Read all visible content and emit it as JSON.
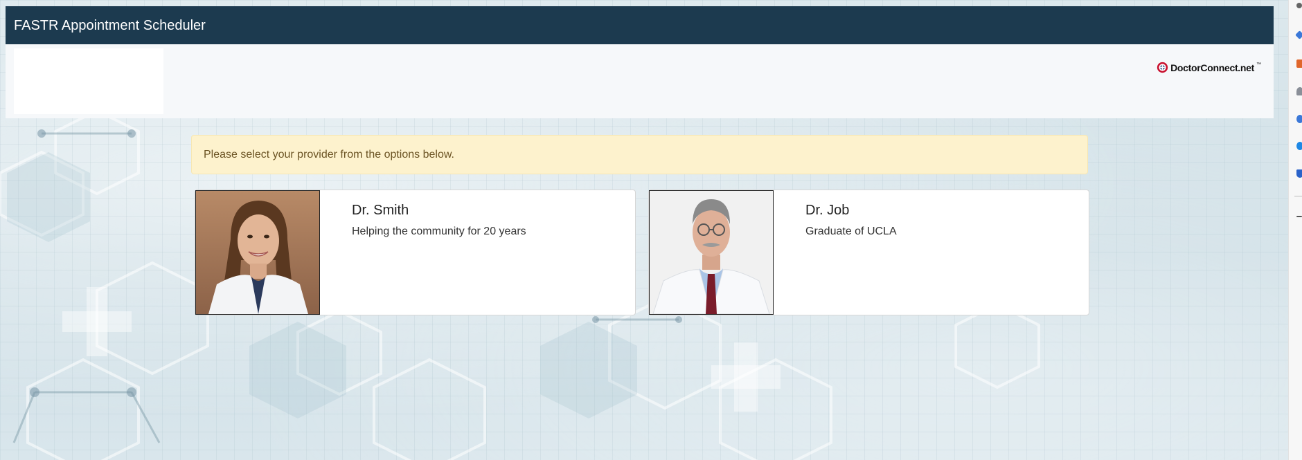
{
  "header": {
    "title": "FASTR Appointment Scheduler"
  },
  "branding": {
    "partner_logo_text": "DoctorConnect.net",
    "partner_logo_tm": "™",
    "header_color": "#1c3a4f"
  },
  "alert": {
    "message": "Please select your provider from the options below."
  },
  "providers": [
    {
      "name": "Dr. Smith",
      "description": "Helping the community for 20 years",
      "photo_icon": "female-doctor-portrait"
    },
    {
      "name": "Dr. Job",
      "description": "Graduate of UCLA",
      "photo_icon": "male-doctor-portrait"
    }
  ],
  "sidebar_icons": [
    "search-icon",
    "bookmark-icon",
    "briefcase-icon",
    "person-icon",
    "chat-icon",
    "settings-icon",
    "shopping-icon",
    "add-icon"
  ]
}
